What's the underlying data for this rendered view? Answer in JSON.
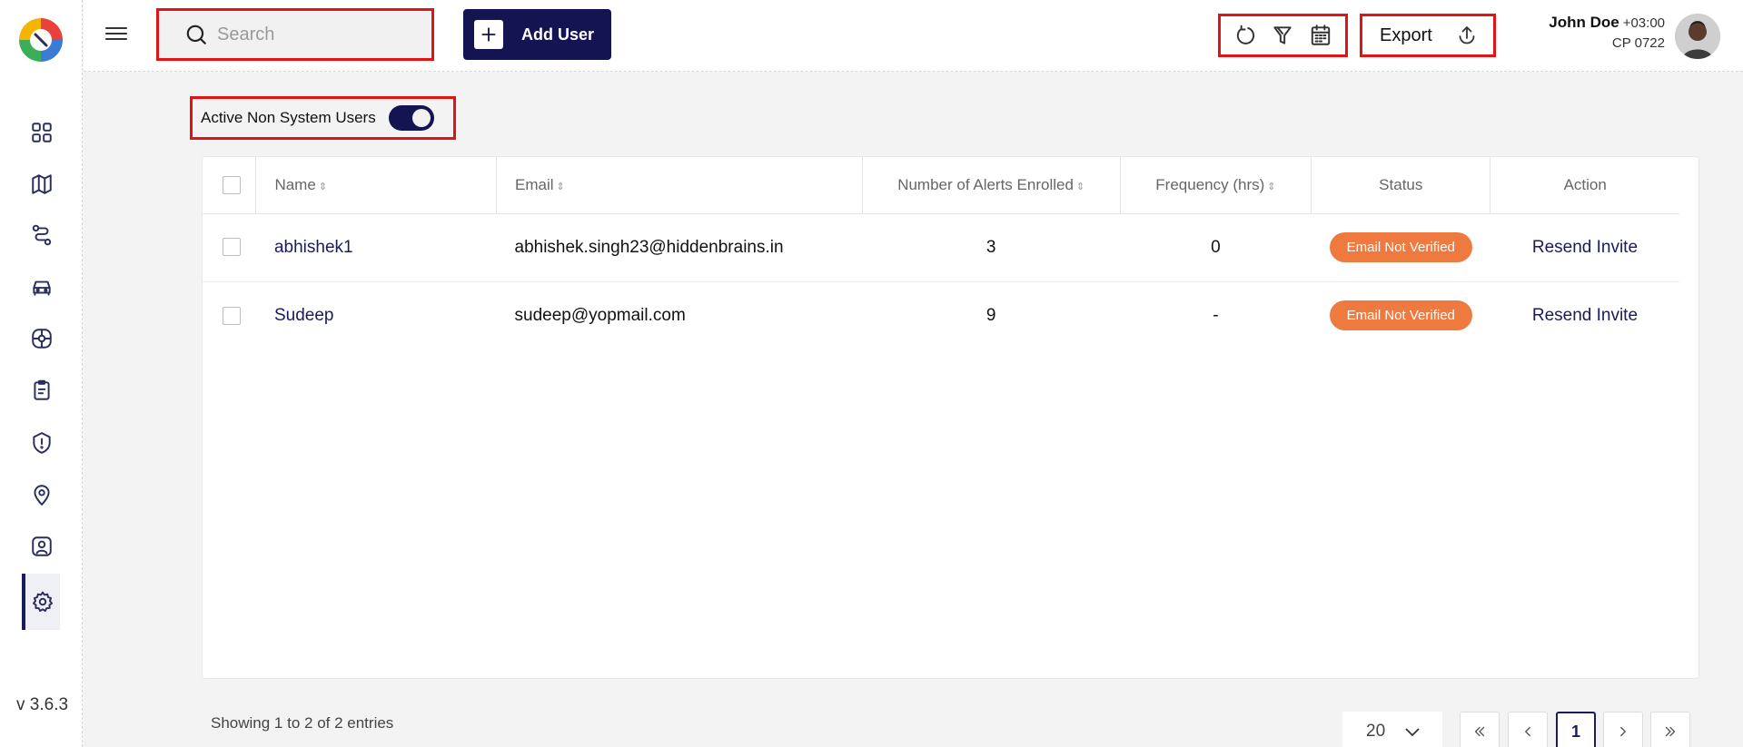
{
  "sidebar": {
    "version": "v 3.6.3",
    "items": [
      {
        "icon": "dashboard-icon"
      },
      {
        "icon": "map-icon"
      },
      {
        "icon": "route-icon"
      },
      {
        "icon": "car-icon"
      },
      {
        "icon": "tire-icon"
      },
      {
        "icon": "clipboard-icon"
      },
      {
        "icon": "alert-shield-icon"
      },
      {
        "icon": "location-pin-icon"
      },
      {
        "icon": "user-profile-icon"
      },
      {
        "icon": "gear-icon",
        "active": true
      }
    ]
  },
  "header": {
    "search_placeholder": "Search",
    "add_user_label": "Add User",
    "export_label": "Export",
    "user": {
      "name": "John Doe",
      "timezone": "+03:00",
      "code": "CP 0722"
    }
  },
  "filter": {
    "toggle_label": "Active Non System Users",
    "toggle_on": true
  },
  "table": {
    "columns": [
      "Name",
      "Email",
      "Number of Alerts Enrolled",
      "Frequency (hrs)",
      "Status",
      "Action"
    ],
    "rows": [
      {
        "name": "abhishek1",
        "email": "abhishek.singh23@hiddenbrains.in",
        "alerts": "3",
        "frequency": "0",
        "status": "Email Not Verified",
        "action": "Resend Invite"
      },
      {
        "name": "Sudeep",
        "email": "sudeep@yopmail.com",
        "alerts": "9",
        "frequency": "-",
        "status": "Email Not Verified",
        "action": "Resend Invite"
      }
    ]
  },
  "footer": {
    "showing": "Showing 1 to 2 of 2 entries",
    "page_size": "20",
    "current_page": "1"
  },
  "colors": {
    "primary": "#141452",
    "status_badge": "#ef7a3f",
    "highlight": "#e11414"
  }
}
